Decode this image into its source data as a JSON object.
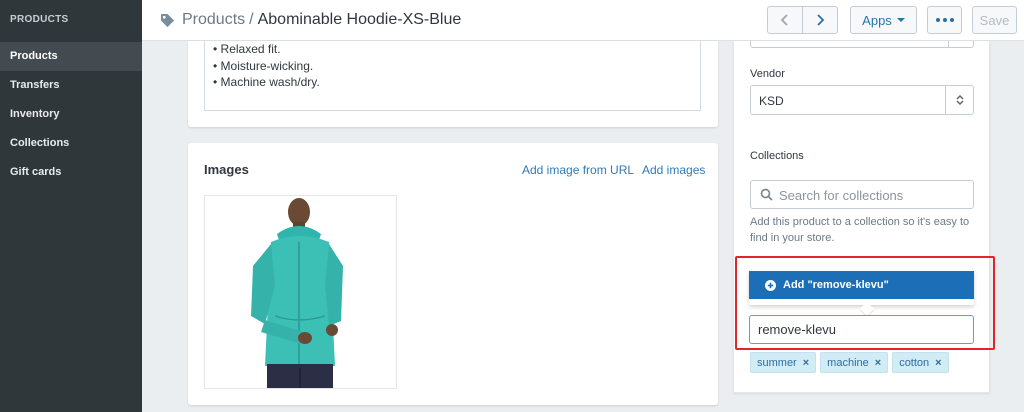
{
  "sidebar": {
    "heading": "PRODUCTS",
    "items": [
      {
        "label": "Products",
        "active": true
      },
      {
        "label": "Transfers"
      },
      {
        "label": "Inventory"
      },
      {
        "label": "Collections"
      },
      {
        "label": "Gift cards"
      }
    ]
  },
  "header": {
    "breadcrumb_link": "Products",
    "separator": "/",
    "title": "Abominable Hoodie-XS-Blue",
    "apps_label": "Apps",
    "save_label": "Save"
  },
  "description": {
    "lines": [
      "• Relaxed fit.",
      "• Moisture-wicking.",
      "• Machine wash/dry."
    ]
  },
  "images": {
    "title": "Images",
    "add_from_url": "Add image from URL",
    "add_images": "Add images"
  },
  "organization": {
    "vendor_label": "Vendor",
    "vendor_value": "KSD",
    "collections_label": "Collections",
    "search_placeholder": "Search for collections",
    "help_text": "Add this product to a collection so it's easy to find in your store.",
    "dropdown_item": "Add \"remove-klevu\"",
    "collection_input_value": "remove-klevu",
    "tags": [
      "summer",
      "machine",
      "cotton"
    ],
    "tag_remove": "×"
  },
  "colors": {
    "accent": "#1c6eb7",
    "highlight": "#e0262b",
    "sidebar": "#30373b"
  }
}
